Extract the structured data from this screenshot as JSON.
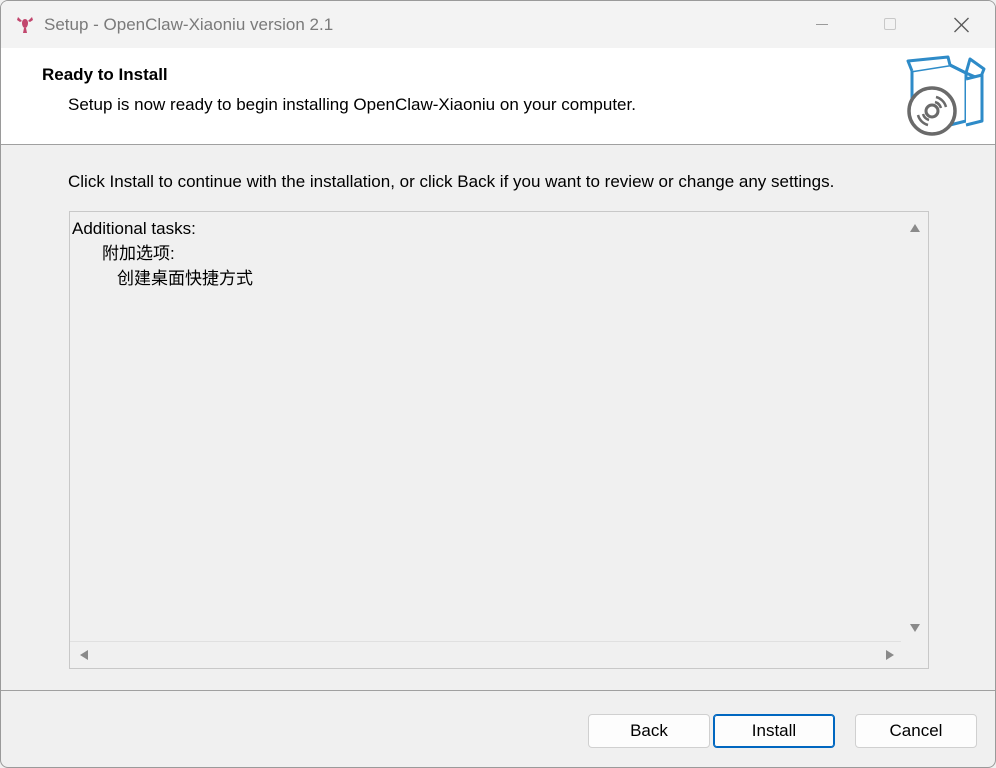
{
  "window": {
    "title": "Setup - OpenClaw-Xiaoniu version 2.1",
    "app_icon": "lobster-icon",
    "controls": [
      "minimize-icon",
      "maximize-icon",
      "close-icon"
    ]
  },
  "header": {
    "title": "Ready to Install",
    "subtitle": "Setup is now ready to begin installing OpenClaw-Xiaoniu on your computer.",
    "graphic": "install-box-disc-icon"
  },
  "main": {
    "instruction": "Click Install to continue with the installation, or click Back if you want to review or change any settings.",
    "memo_lines": [
      "Additional tasks:",
      "附加选项:",
      "创建桌面快捷方式"
    ]
  },
  "buttons": {
    "back": "Back",
    "install": "Install",
    "cancel": "Cancel"
  },
  "colors": {
    "accent": "#0067c0",
    "graphic_blue": "#2e8bc8",
    "icon_pink": "#c2476e"
  }
}
